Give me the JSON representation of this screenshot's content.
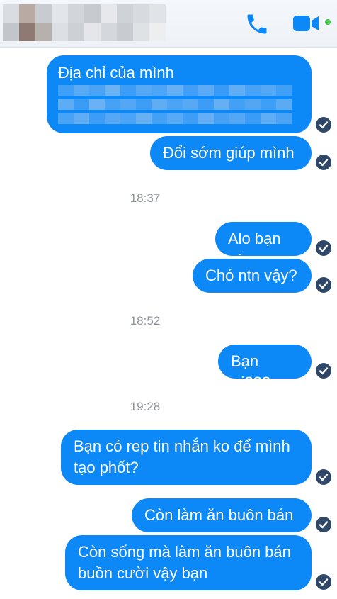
{
  "header": {
    "contact_name_redacted": true,
    "icons": {
      "call": "phone-icon",
      "video": "video-camera-icon",
      "status": "online-dot"
    },
    "colors": {
      "icon": "#0d88f7",
      "online": "#42c74a"
    }
  },
  "messages": [
    {
      "text": "Địa chỉ của mình",
      "note": ""
    },
    {
      "text": "Đổi sớm giúp mình"
    },
    {
      "text": "Alo bạn ơi"
    },
    {
      "text": "Chó ntn vậy?"
    },
    {
      "text": "Bạn ơi???"
    },
    {
      "line1": "Bạn có rep tin nhắn ko để mình",
      "line2": "tạo phốt?"
    },
    {
      "text": "Còn làm ăn buôn bán"
    },
    {
      "line1": "Còn sống mà làm ăn buôn bán",
      "line2": "buồn cười vậy bạn"
    }
  ],
  "timestamps": [
    "18:37",
    "18:52",
    "19:28"
  ],
  "colors": {
    "bubble": "#0d88f7",
    "bubble_text": "#ffffff",
    "timestamp": "#8e949b",
    "check": "#2f4868"
  },
  "status_icon": "delivered-check-icon"
}
